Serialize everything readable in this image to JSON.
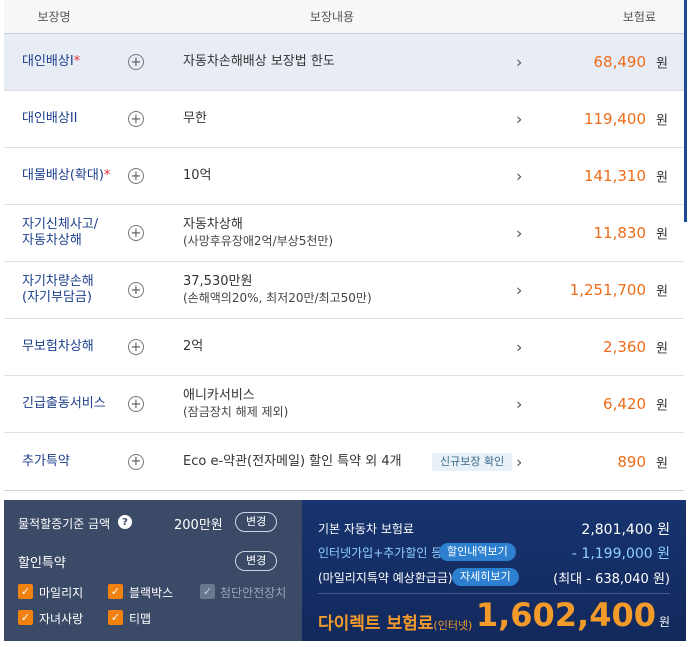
{
  "header": {
    "name": "보장명",
    "content": "보장내용",
    "premium": "보험료"
  },
  "rows": [
    {
      "name": "대인배상I",
      "star": "*",
      "content": "자동차손해배상 보장법 한도",
      "sub": "",
      "badge": "",
      "amount": "68,490",
      "unit": "원"
    },
    {
      "name": "대인배상II",
      "star": "",
      "content": "무한",
      "sub": "",
      "badge": "",
      "amount": "119,400",
      "unit": "원"
    },
    {
      "name": "대물배상(확대)",
      "star": "*",
      "content": "10억",
      "sub": "",
      "badge": "",
      "amount": "141,310",
      "unit": "원"
    },
    {
      "name": "자기신체사고/",
      "name2": "자동차상해",
      "star": "",
      "content": "자동차상해",
      "sub": "(사망후유장애2억/부상5천만)",
      "badge": "",
      "amount": "11,830",
      "unit": "원"
    },
    {
      "name": "자기차량손해",
      "name2": "(자기부담금)",
      "star": "",
      "content": "37,530만원",
      "sub": "(손해액의20%, 최저20만/최고50만)",
      "badge": "",
      "amount": "1,251,700",
      "unit": "원"
    },
    {
      "name": "무보험차상해",
      "star": "",
      "content": "2억",
      "sub": "",
      "badge": "",
      "amount": "2,360",
      "unit": "원"
    },
    {
      "name": "긴급출동서비스",
      "star": "",
      "content": "애니카서비스",
      "sub": "(잠금장치 해제 제외)",
      "badge": "",
      "amount": "6,420",
      "unit": "원"
    },
    {
      "name": "추가특약",
      "star": "",
      "content": "Eco e-약관(전자메일) 할인 특약 외 4개",
      "sub": "",
      "badge": "신규보장 확인",
      "amount": "890",
      "unit": "원"
    }
  ],
  "left_panel": {
    "property_label": "물적할증기준 금액",
    "property_value": "200만원",
    "change_label": "변경",
    "discount_label": "할인특약",
    "discount_change_label": "변경",
    "checkboxes": [
      {
        "label": "마일리지",
        "checked": true,
        "disabled": false
      },
      {
        "label": "블랙박스",
        "checked": true,
        "disabled": false
      },
      {
        "label": "첨단안전장치",
        "checked": true,
        "disabled": true
      },
      {
        "label": "자녀사랑",
        "checked": true,
        "disabled": false
      },
      {
        "label": "티맵",
        "checked": true,
        "disabled": false
      }
    ]
  },
  "right_panel": {
    "base_label": "기본 자동차 보험료",
    "base_value": "2,801,400 원",
    "discount_label": "인터넷가입+추가할인 등",
    "discount_chip": "할인내역보기",
    "discount_value": "- 1,199,000 원",
    "mileage_label": "(마일리지특약 예상환급금)",
    "mileage_chip": "자세히보기",
    "mileage_value": "(최대 - 638,040 원)",
    "total_label": "다이렉트 보험료",
    "total_label_small": "(인터넷)",
    "total_value": "1,602,400",
    "total_unit": "원"
  },
  "colors": {
    "accent_orange": "#ef6c1a",
    "navy": "#17346f",
    "coverage_blue": "#1d3f8c"
  }
}
